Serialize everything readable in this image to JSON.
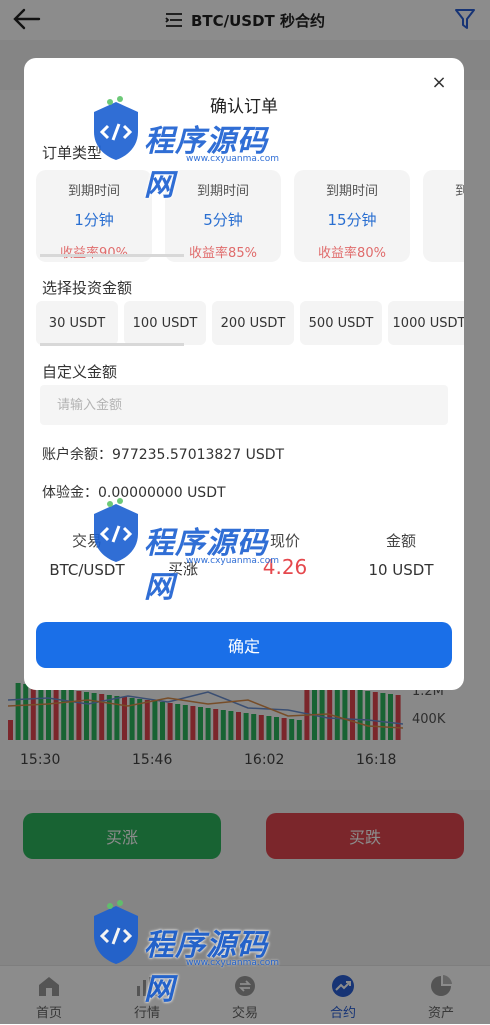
{
  "header": {
    "title": "BTC/USDT 秒合约"
  },
  "background": {
    "time_ticks": [
      "15:30",
      "15:46",
      "16:02",
      "16:18"
    ],
    "volume_ticks": [
      "1.2M",
      "400K"
    ],
    "buy_up_label": "买涨",
    "buy_down_label": "买跌"
  },
  "tabbar": {
    "items": [
      {
        "label": "首页",
        "icon": "home-icon"
      },
      {
        "label": "行情",
        "icon": "bars-icon"
      },
      {
        "label": "交易",
        "icon": "trade-icon"
      },
      {
        "label": "合约",
        "icon": "trend-icon"
      },
      {
        "label": "资产",
        "icon": "pie-icon"
      }
    ],
    "active_index": 3
  },
  "modal": {
    "title": "确认订单",
    "close_label": "×",
    "order_type_label": "订单类型",
    "periods": [
      {
        "label": "到期时间",
        "value": "1分钟",
        "rate": "收益率90%"
      },
      {
        "label": "到期时间",
        "value": "5分钟",
        "rate": "收益率85%"
      },
      {
        "label": "到期时间",
        "value": "15分钟",
        "rate": "收益率80%"
      },
      {
        "label": "到期时间",
        "value": "",
        "rate": "收"
      }
    ],
    "amount_label": "选择投资金额",
    "amounts": [
      "30 USDT",
      "100 USDT",
      "200 USDT",
      "500 USDT",
      "1000 USDT"
    ],
    "custom_label": "自定义金额",
    "custom_placeholder": "请输入金额",
    "balance_line": "账户余额：977235.57013827 USDT",
    "trial_line": "体验金：0.00000000 USDT",
    "summary": {
      "pair_header": "交易",
      "pair_value": "BTC/USDT",
      "direction_value": "买涨",
      "price_header": "现价",
      "price_value": "4.26",
      "amount_header": "金额",
      "amount_value": "10 USDT"
    },
    "confirm_label": "确定"
  },
  "watermark": {
    "text": "程序源码网",
    "url": "www.cxyuanma.com"
  },
  "colors": {
    "accent": "#1a6fe8",
    "up": "#2db55d",
    "down": "#e0464f",
    "rate": "#e06c6c"
  }
}
